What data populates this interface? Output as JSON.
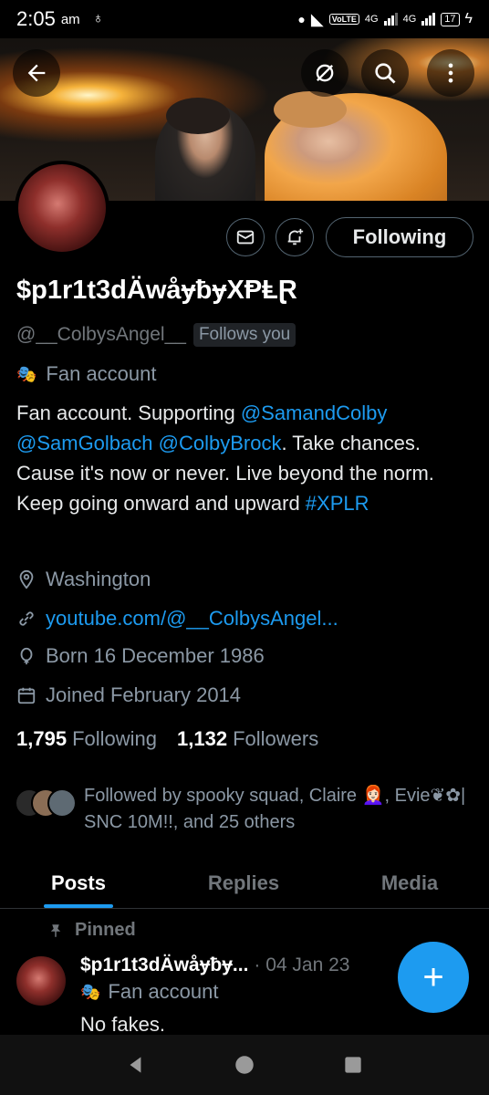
{
  "status_bar": {
    "time": "2:05",
    "ampm": "am",
    "volte": "VoLTE",
    "net1": "4G",
    "net2": "4G",
    "battery": "17"
  },
  "colors": {
    "accent": "#1d9bf0",
    "background": "#000000",
    "muted": "#71767b"
  },
  "header": {
    "back_icon": "arrow-left-icon",
    "grok_icon": "grok-icon",
    "search_icon": "search-icon",
    "more_icon": "more-vertical-icon"
  },
  "profile": {
    "display_name": "$p1r1t3dÄwåɏƀɏXⱣⱠⱤ",
    "handle": "@__ColbysAngel__",
    "follows_you": "Follows you",
    "category": "Fan account",
    "bio_parts": {
      "p1": "Fan account. Supporting ",
      "m1": "@SamandColby",
      "m2": "@SamGolbach",
      "m3": "@ColbyBrock",
      "p2": ". Take chances. Cause it's now or never. Live beyond the norm. Keep going onward and upward ",
      "hashtag": "#XPLR"
    },
    "location": "Washington",
    "website": "youtube.com/@__ColbysAngel...",
    "birthday": "Born 16 December 1986",
    "joined": "Joined February 2014",
    "following_count": "1,795",
    "following_label": "Following",
    "followers_count": "1,132",
    "followers_label": "Followers",
    "followed_by": "Followed by spooky squad, Claire 👩🏻‍🦰, Evie❦✿| SNC 10M!!, and 25 others"
  },
  "actions": {
    "following_button": "Following"
  },
  "tabs": [
    {
      "label": "Posts"
    },
    {
      "label": "Replies"
    },
    {
      "label": "Media"
    }
  ],
  "pinned_post": {
    "pinned_label": "Pinned",
    "author": "$p1r1t3dÄwåɏƀɏ...",
    "date": "· 04 Jan 23",
    "category": "Fan account",
    "text": "No fakes."
  },
  "fab": {
    "label": "+"
  }
}
